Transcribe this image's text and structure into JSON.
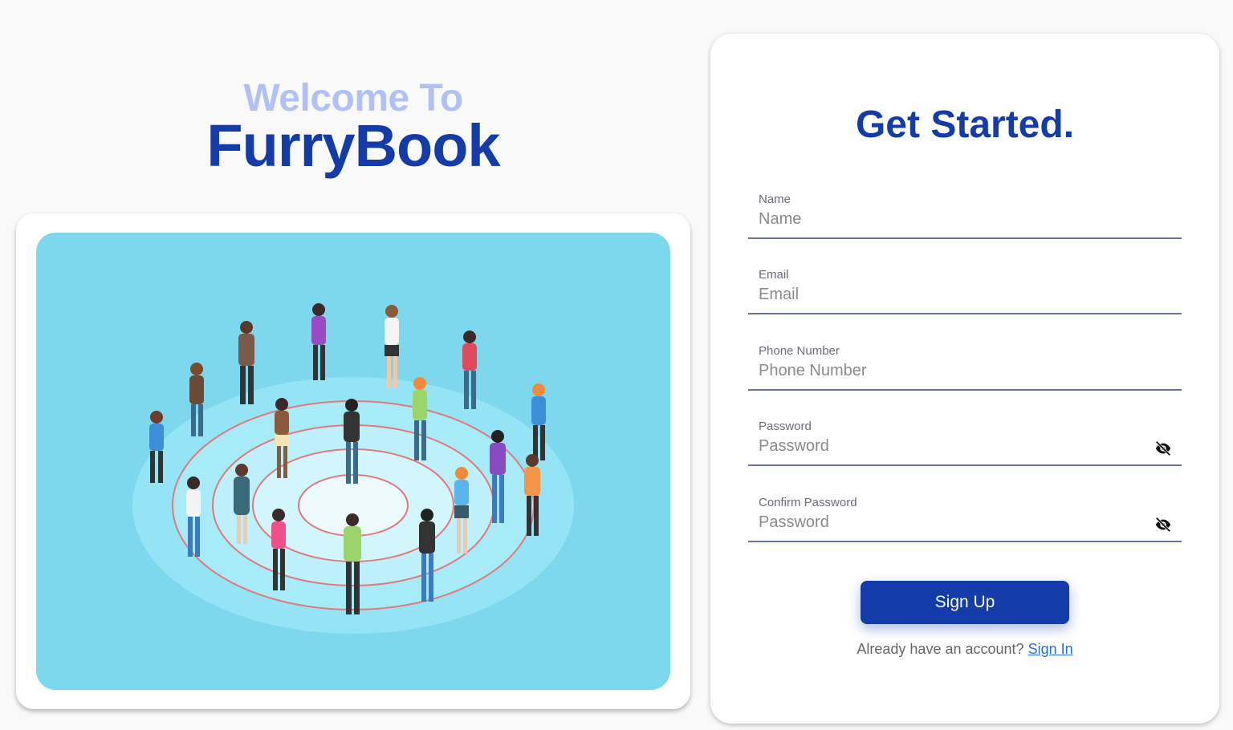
{
  "hero": {
    "welcome": "Welcome To",
    "brand": "FurryBook",
    "illustration_icon": "people-crowd-illustration"
  },
  "form": {
    "title": "Get Started.",
    "fields": [
      {
        "label": "Name",
        "placeholder": "Name",
        "value": ""
      },
      {
        "label": "Email",
        "placeholder": "Email",
        "value": ""
      },
      {
        "label": "Phone Number",
        "placeholder": "Phone Number",
        "value": ""
      },
      {
        "label": "Password",
        "placeholder": "Password",
        "value": "",
        "toggle_icon": "eye-off-icon"
      },
      {
        "label": "Confirm Password",
        "placeholder": "Password",
        "value": "",
        "toggle_icon": "eye-off-icon"
      }
    ],
    "submit_label": "Sign Up",
    "signin_prompt": "Already have an account?",
    "signin_link": "Sign In"
  },
  "colors": {
    "brand": "#143ca8",
    "welcome": "#b1c1f6",
    "illustration_bg": "#7dd8ee",
    "link": "#2b6fd6"
  }
}
